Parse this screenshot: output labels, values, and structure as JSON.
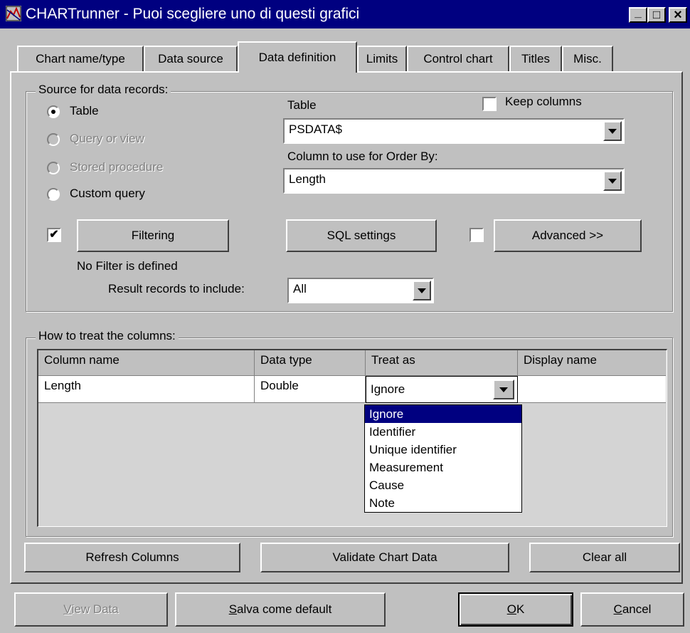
{
  "window": {
    "title": "CHARTrunner - Puoi scegliere uno di questi grafici",
    "minimize_glyph": "_",
    "maximize_glyph": "□",
    "close_glyph": "×"
  },
  "tabs": [
    {
      "label": "Chart name/type"
    },
    {
      "label": "Data source"
    },
    {
      "label": "Data definition"
    },
    {
      "label": "Limits"
    },
    {
      "label": "Control chart"
    },
    {
      "label": "Titles"
    },
    {
      "label": "Misc."
    }
  ],
  "active_tab": "Data definition",
  "source": {
    "group_label": "Source for data records:",
    "radios": [
      {
        "label": "Table",
        "checked": true,
        "enabled": true
      },
      {
        "label": "Query or view",
        "checked": false,
        "enabled": false
      },
      {
        "label": "Stored procedure",
        "checked": false,
        "enabled": false
      },
      {
        "label": "Custom query",
        "checked": false,
        "enabled": true
      }
    ],
    "table_label": "Table",
    "table_value": "PSDATA$",
    "keep_columns_label": "Keep columns",
    "keep_columns_checked": false,
    "order_by_label": "Column to use for Order By:",
    "order_by_value": "Length",
    "filtering_checked": true,
    "filtering_button": "Filtering",
    "filter_status": "No Filter is defined",
    "sql_settings_button": "SQL settings",
    "advanced_checked": false,
    "advanced_button": "Advanced >>",
    "result_records_label": "Result records to include:",
    "result_records_value": "All"
  },
  "columns": {
    "group_label": "How to treat the columns:",
    "headers": [
      "Column name",
      "Data type",
      "Treat as",
      "Display name"
    ],
    "rows": [
      {
        "column_name": "Length",
        "data_type": "Double",
        "treat_as": "Ignore",
        "display_name": ""
      }
    ],
    "treat_as_options": [
      "Ignore",
      "Identifier",
      "Unique identifier",
      "Measurement",
      "Cause",
      "Note"
    ],
    "selected_option": "Ignore"
  },
  "actions": {
    "refresh_columns": "Refresh Columns",
    "validate_chart_data": "Validate Chart Data",
    "clear_all": "Clear all"
  },
  "footer": {
    "view_data_first": "V",
    "view_data_rest": "iew Data",
    "salva_first": "S",
    "salva_rest": "alva come default",
    "ok_first": "O",
    "ok_rest": "K",
    "cancel_first": "C",
    "cancel_rest": "ancel"
  },
  "colors": {
    "title_bar": "#000080",
    "face": "#c0c0c0",
    "selection": "#000080"
  }
}
